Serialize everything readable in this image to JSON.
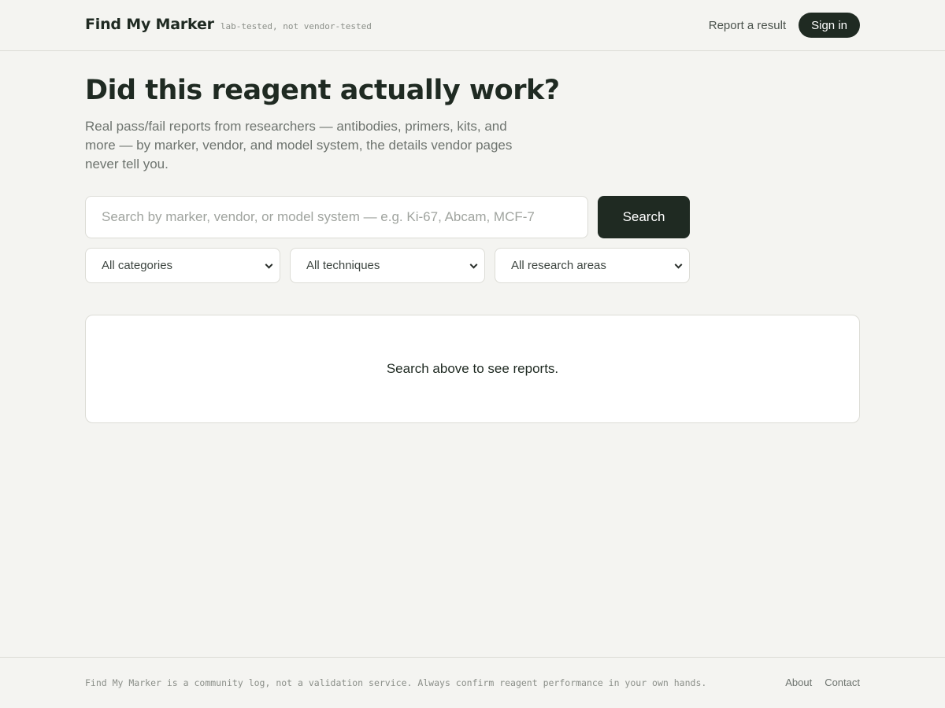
{
  "header": {
    "brand_name": "Find My Marker",
    "tagline": "lab-tested, not vendor-tested",
    "report_link": "Report a result",
    "signin_label": "Sign in"
  },
  "hero": {
    "title": "Did this reagent actually work?",
    "subtitle": "Real pass/fail reports from researchers — antibodies, primers, kits, and more — by marker, vendor, and model system, the details vendor pages never tell you."
  },
  "search": {
    "value": "",
    "placeholder": "Search by marker, vendor, or model system — e.g. Ki-67, Abcam, MCF-7",
    "button_label": "Search"
  },
  "filters": {
    "category": "All categories",
    "technique": "All techniques",
    "research_area": "All research areas"
  },
  "results": {
    "empty_message": "Search above to see reports."
  },
  "footer": {
    "note": "Find My Marker is a community log, not a validation service. Always confirm reagent performance in your own hands.",
    "about": "About",
    "contact": "Contact"
  },
  "colors": {
    "background": "#f4f4f1",
    "primary": "#1f2a22",
    "border": "#dcdcd6",
    "muted_text": "#6e746f"
  },
  "icons": {
    "select_caret": "chevron-down-icon"
  }
}
